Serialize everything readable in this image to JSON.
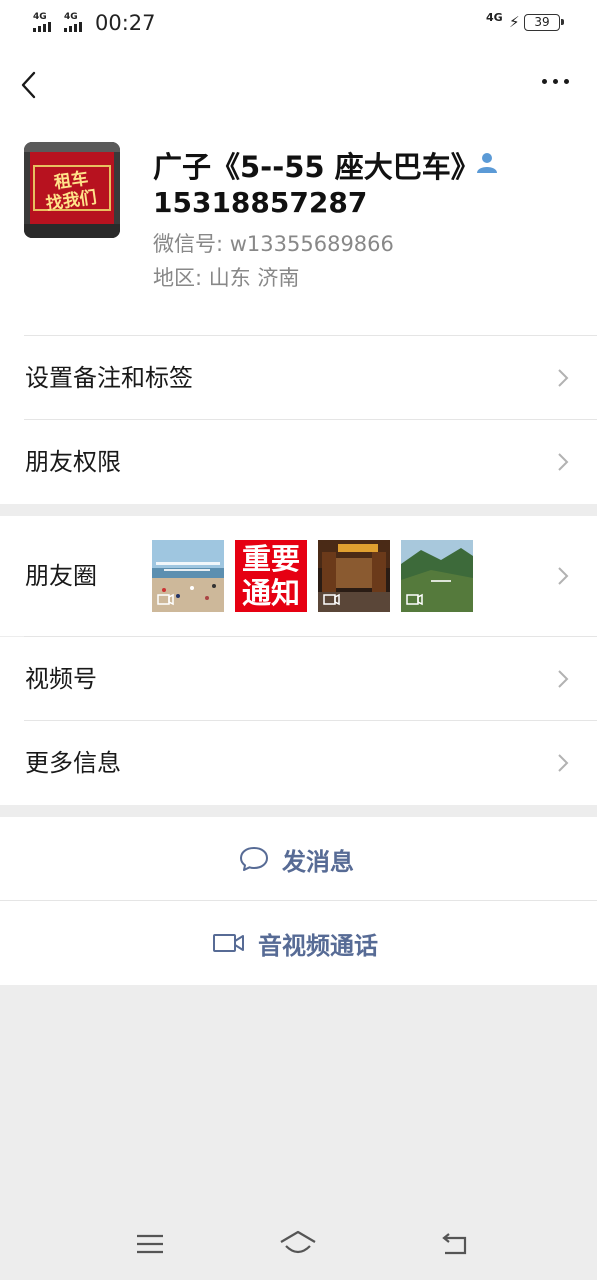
{
  "status_bar": {
    "signal1_label": "4G",
    "signal2_label": "4G",
    "time": "00:27",
    "network": "4G",
    "battery": "39"
  },
  "profile": {
    "name": "广子《5--55 座大巴车》",
    "phone": "15318857287",
    "wechat_id": "微信号: w13355689866",
    "region": "地区: 山东  济南",
    "avatar_text": "租车\n找我们"
  },
  "menu": {
    "remark_label": "设置备注和标签",
    "permission_label": "朋友权限",
    "moments_label": "朋友圈",
    "channels_label": "视频号",
    "more_info_label": "更多信息"
  },
  "moments_thumbs": [
    {
      "kind": "video",
      "theme": "beach"
    },
    {
      "kind": "text",
      "theme": "red-notice",
      "text_line1": "重要",
      "text_line2": "通知"
    },
    {
      "kind": "video",
      "theme": "night-street"
    },
    {
      "kind": "video",
      "theme": "mountain"
    }
  ],
  "actions": {
    "message_label": "发消息",
    "call_label": "音视频通话"
  },
  "colors": {
    "link_blue": "#576b95",
    "background": "#ededed",
    "notice_red": "#e60012"
  },
  "icons": [
    "back-icon",
    "more-icon",
    "person-icon",
    "chevron-right-icon",
    "chat-bubble-icon",
    "video-camera-icon",
    "menu-icon",
    "home-icon",
    "return-icon"
  ]
}
